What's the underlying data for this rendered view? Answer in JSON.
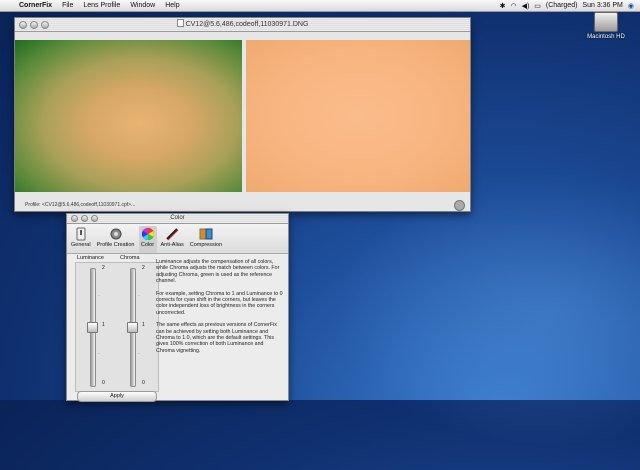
{
  "menubar": {
    "app_name": "CornerFix",
    "items": [
      "File",
      "Lens Profile",
      "Window",
      "Help"
    ],
    "status": {
      "battery": "(Charged)",
      "clock": "Sun 3:36 PM"
    }
  },
  "desktop": {
    "hd_label": "Macintosh HD"
  },
  "main_window": {
    "title": "CV12@5.6,486,codeoff,11030971.DNG",
    "profile_text": "Profile: <CV12@5.6,486,codeoff,11030971.cpf>..."
  },
  "color_window": {
    "title": "Color",
    "toolbar": [
      {
        "label": "General",
        "icon": "switch-icon"
      },
      {
        "label": "Profile Creation",
        "icon": "gear-icon"
      },
      {
        "label": "Color",
        "icon": "color-wheel-icon"
      },
      {
        "label": "Anti-Alias",
        "icon": "pen-icon"
      },
      {
        "label": "Compression",
        "icon": "compression-icon"
      }
    ],
    "luminance_label": "Luminance",
    "chroma_label": "Chroma",
    "luminance": {
      "max": "2",
      "mid": "1",
      "min": "0",
      "value": 1
    },
    "chroma": {
      "max": "2",
      "mid": "1",
      "min": "0",
      "value": 1
    },
    "apply_label": "Apply",
    "description": [
      "Luminance adjusts the compensation of all colors, while Chroma adjusts the match between colors. For adjusting Chroma, green is used as the reference channel.",
      "For example, setting Chroma to 1 and Luminance to 0 corrects for cyan shift in the corners, but leaves the color independent loss of brightness in the corners uncorrected.",
      "The same effects as previous versions of CornerFix can be achieved by setting both Luminance and Chroma to 1.0, which are the default settings. This gives 100% correction of both Luminance and Chroma vignetting."
    ]
  }
}
